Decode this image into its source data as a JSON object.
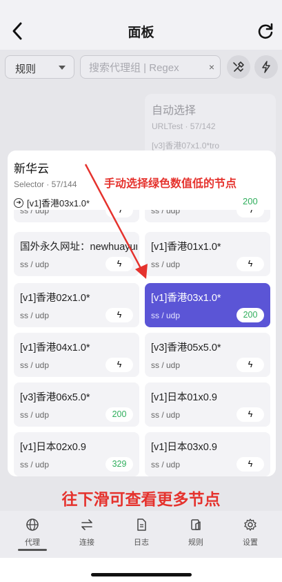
{
  "header": {
    "title": "面板"
  },
  "toolbar": {
    "mode_select": "规则",
    "search_placeholder": "搜索代理组 | Regex",
    "clear": "×"
  },
  "background_group": {
    "name": "自动选择",
    "meta": "URLTest · 57/142",
    "selected": "[v3]香港07x1.0*tro"
  },
  "group": {
    "name": "新华云",
    "meta": "Selector · 57/144",
    "current": "[v1]香港03x1.0*",
    "current_delay": "200"
  },
  "nodes": [
    {
      "name": "",
      "type": "ss / udp",
      "delay": ""
    },
    {
      "name": "",
      "type": "ss / udp",
      "delay": ""
    },
    {
      "name": "国外永久网址：newhuayun.com",
      "type": "ss / udp",
      "delay": ""
    },
    {
      "name": "[v1]香港01x1.0*",
      "type": "ss / udp",
      "delay": ""
    },
    {
      "name": "[v1]香港02x1.0*",
      "type": "ss / udp",
      "delay": ""
    },
    {
      "name": "[v1]香港03x1.0*",
      "type": "ss / udp",
      "delay": "200",
      "active": true
    },
    {
      "name": "[v1]香港04x1.0*",
      "type": "ss / udp",
      "delay": ""
    },
    {
      "name": "[v3]香港05x5.0*",
      "type": "ss / udp",
      "delay": ""
    },
    {
      "name": "[v3]香港06x5.0*",
      "type": "ss / udp",
      "delay": "200"
    },
    {
      "name": "[v1]日本01x0.9",
      "type": "ss / udp",
      "delay": ""
    },
    {
      "name": "[v1]日本02x0.9",
      "type": "ss / udp",
      "delay": "329"
    },
    {
      "name": "[v1]日本03x0.9",
      "type": "ss / udp",
      "delay": ""
    }
  ],
  "annotations": {
    "top": "手动选择绿色数值低的节点",
    "bottom": "往下滑可查看更多节点"
  },
  "colors": {
    "accent": "#5b55d6",
    "delay_green": "#2fae5c",
    "annotation_red": "#e5322d"
  },
  "bottom_nav": [
    {
      "label": "代理",
      "icon": "globe-icon"
    },
    {
      "label": "连接",
      "icon": "swap-icon"
    },
    {
      "label": "日志",
      "icon": "document-icon"
    },
    {
      "label": "规则",
      "icon": "rules-icon"
    },
    {
      "label": "设置",
      "icon": "gear-icon"
    }
  ]
}
